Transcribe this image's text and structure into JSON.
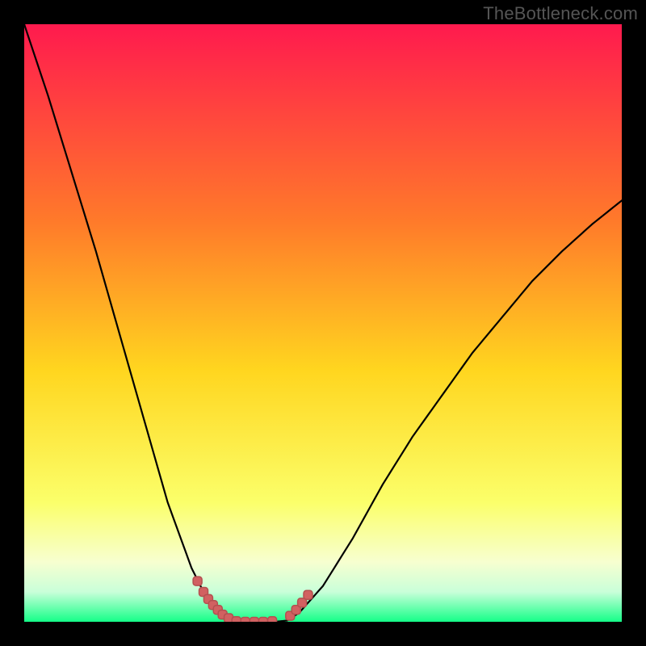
{
  "watermark": "TheBottleneck.com",
  "colors": {
    "black": "#000000",
    "grad_top": "#ff1a4e",
    "grad_mid1": "#ff7a2a",
    "grad_mid2": "#ffd61f",
    "grad_low": "#fbff6a",
    "grad_band_light": "#f7ffd0",
    "grad_green_pale": "#c9ffd9",
    "grad_green": "#15ff88",
    "curve": "#000000",
    "highlight": "#d16161"
  },
  "chart_data": {
    "type": "line",
    "title": "",
    "xlabel": "",
    "ylabel": "",
    "x": [
      0.0,
      0.04,
      0.08,
      0.12,
      0.16,
      0.2,
      0.24,
      0.28,
      0.3,
      0.32,
      0.34,
      0.36,
      0.38,
      0.4,
      0.42,
      0.44,
      0.46,
      0.5,
      0.55,
      0.6,
      0.65,
      0.7,
      0.75,
      0.8,
      0.85,
      0.9,
      0.95,
      1.0
    ],
    "series": [
      {
        "name": "bottleneck-curve",
        "values": [
          1.0,
          0.88,
          0.75,
          0.62,
          0.48,
          0.34,
          0.2,
          0.09,
          0.05,
          0.022,
          0.01,
          0.003,
          0.0,
          0.0,
          0.0,
          0.002,
          0.015,
          0.06,
          0.14,
          0.23,
          0.31,
          0.38,
          0.45,
          0.51,
          0.57,
          0.62,
          0.665,
          0.705
        ]
      }
    ],
    "highlight_segments": [
      {
        "side": "left",
        "x": [
          0.29,
          0.3,
          0.308,
          0.316,
          0.324,
          0.332,
          0.342
        ],
        "y": [
          0.068,
          0.05,
          0.038,
          0.028,
          0.02,
          0.012,
          0.006
        ]
      },
      {
        "side": "floor",
        "x": [
          0.355,
          0.37,
          0.385,
          0.4,
          0.415
        ],
        "y": [
          0.001,
          0.0,
          0.0,
          0.0,
          0.001
        ]
      },
      {
        "side": "right",
        "x": [
          0.445,
          0.455,
          0.465,
          0.475
        ],
        "y": [
          0.01,
          0.02,
          0.032,
          0.045
        ]
      }
    ],
    "xlim": [
      0,
      1
    ],
    "ylim": [
      0,
      1
    ],
    "grid": false,
    "legend": false
  }
}
